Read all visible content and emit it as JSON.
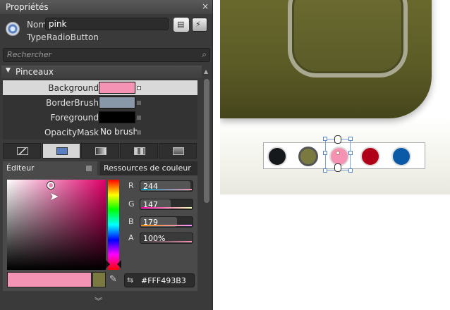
{
  "panel": {
    "title": "Propriétés",
    "close_icon": "×",
    "name_label": "Nom",
    "name_value": "pink",
    "type_label": "Type",
    "type_value": "RadioButton",
    "search_placeholder": "Rechercher",
    "section_title": "Pinceaux",
    "brushes": [
      {
        "name": "Background",
        "color": "#f493b3",
        "selected": true
      },
      {
        "name": "BorderBrush",
        "color": "#8898a8",
        "selected": false
      },
      {
        "name": "Foreground",
        "color": "#000000",
        "selected": false
      },
      {
        "name": "OpacityMask",
        "value_text": "No brush",
        "selected": false
      }
    ],
    "brush_types": [
      "no-brush",
      "solid-color",
      "gradient",
      "tile",
      "resource"
    ],
    "tabs": {
      "editor": "Éditeur",
      "resources": "Ressources de couleur"
    },
    "channels": [
      {
        "label": "R",
        "value": "244",
        "fraction": 0.957
      },
      {
        "label": "G",
        "value": "147",
        "fraction": 0.576
      },
      {
        "label": "B",
        "value": "179",
        "fraction": 0.702
      },
      {
        "label": "A",
        "value": "100%",
        "fraction": 1.0
      }
    ],
    "hex_value": "#FFF493B3",
    "current_color": "#f493b3",
    "previous_color": "#7a7a40"
  },
  "canvas": {
    "radio_colors": [
      "#15191c",
      "#7a7a40",
      "#f493b3",
      "#b00018",
      "#0a5aa8"
    ],
    "selected_radio": 2
  }
}
